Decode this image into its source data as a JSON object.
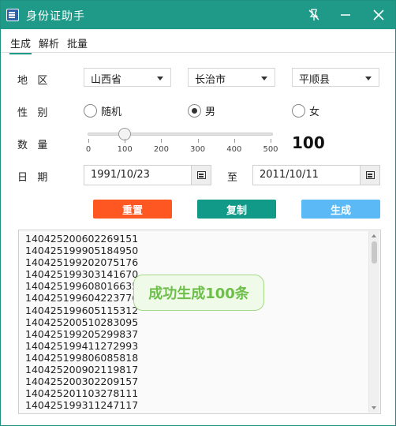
{
  "window": {
    "title": "身份证助手",
    "icon": "app-id-card-icon",
    "controls": {
      "pin": "pin-off-icon",
      "minimize": "minimize-icon",
      "close": "close-icon"
    }
  },
  "tabs": [
    {
      "label": "生成",
      "active": true
    },
    {
      "label": "解析",
      "active": false
    },
    {
      "label": "批量",
      "active": false
    }
  ],
  "region": {
    "label": "地   区",
    "province": "山西省",
    "city": "长治市",
    "county": "平顺县"
  },
  "gender": {
    "label": "性   别",
    "options": [
      {
        "label": "随机",
        "checked": false
      },
      {
        "label": "男",
        "checked": true
      },
      {
        "label": "女",
        "checked": false
      }
    ]
  },
  "quantity": {
    "label": "数   量",
    "value": "100",
    "slider_min": 0,
    "slider_max": 500,
    "slider_value": 100,
    "ticks": [
      "0",
      "100",
      "200",
      "300",
      "400",
      "500"
    ]
  },
  "date": {
    "label": "日   期",
    "from": "1991/10/23",
    "to_label": "至",
    "to": "2011/10/11",
    "calendar_icon": "calendar-icon"
  },
  "actions": {
    "reset": "重置",
    "copy": "复制",
    "generate": "生成",
    "colors": {
      "reset": "#ff5722",
      "copy": "#119a88",
      "generate": "#5bb9f5"
    }
  },
  "results": [
    "140425200602269151",
    "140425199905184950",
    "140425199202075176",
    "140425199303141670",
    "140425199608016635",
    "140425199604223776",
    "140425199605115312",
    "140425200510283095",
    "140425199205299837",
    "140425199411272993",
    "140425199806085818",
    "140425200902119817",
    "140425200302209157",
    "140425201103278111",
    "140425199311247117"
  ],
  "toast": "成功生成100条",
  "accent": "#1f9a88"
}
